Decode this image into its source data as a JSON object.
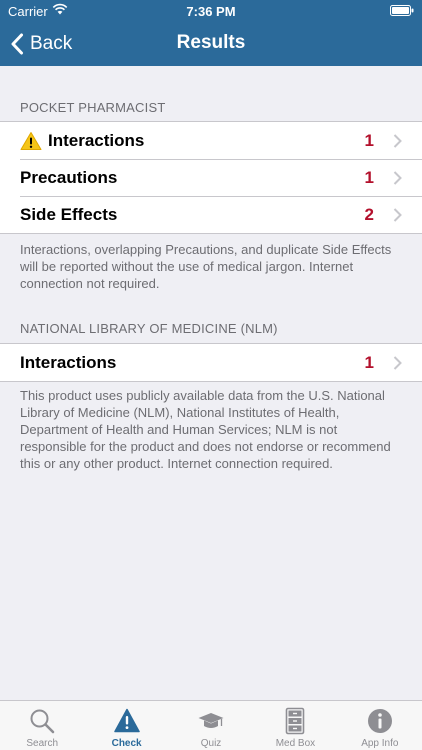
{
  "status": {
    "carrier": "Carrier",
    "time": "7:36 PM"
  },
  "nav": {
    "back_label": "Back",
    "title": "Results"
  },
  "pocket": {
    "header": "POCKET PHARMACIST",
    "rows": [
      {
        "label": "Interactions",
        "count": "1",
        "icon": "warning-icon"
      },
      {
        "label": "Precautions",
        "count": "1"
      },
      {
        "label": "Side Effects",
        "count": "2"
      }
    ],
    "footer": "Interactions, overlapping Precautions, and duplicate Side Effects will be reported without the use of medical jargon. Internet connection not required."
  },
  "nlm": {
    "header": "NATIONAL LIBRARY OF MEDICINE (NLM)",
    "rows": [
      {
        "label": "Interactions",
        "count": "1"
      }
    ],
    "footer": "This product uses publicly available data from the U.S. National Library of Medicine (NLM), National Institutes of Health, Department of Health and Human Services; NLM is not responsible for the product and does not endorse or recommend this or any other product.  Internet connection required."
  },
  "tabs": [
    {
      "label": "Search",
      "icon": "search-icon"
    },
    {
      "label": "Check",
      "icon": "warning-icon",
      "active": true
    },
    {
      "label": "Quiz",
      "icon": "graduation-cap-icon"
    },
    {
      "label": "Med Box",
      "icon": "cabinet-icon"
    },
    {
      "label": "App Info",
      "icon": "info-icon"
    }
  ],
  "colors": {
    "nav": "#2b6a9a",
    "count": "#b3102c",
    "warning": "#f5c518"
  }
}
